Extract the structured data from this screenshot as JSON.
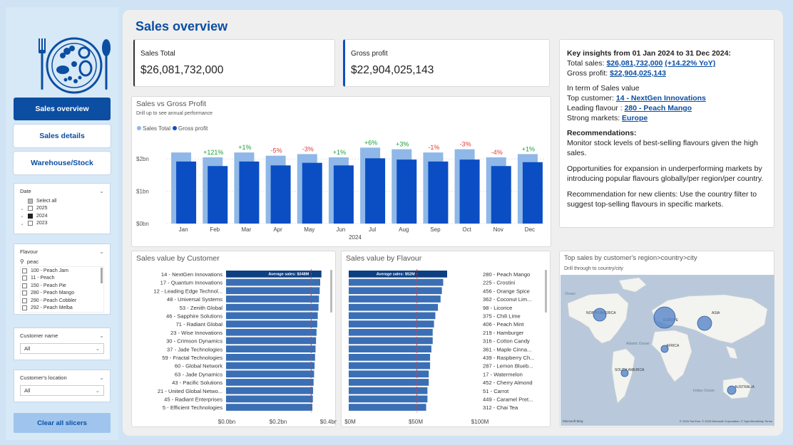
{
  "nav": {
    "buttons": [
      {
        "label": "Sales overview",
        "active": true
      },
      {
        "label": "Sales details",
        "active": false
      },
      {
        "label": "Warehouse/Stock",
        "active": false
      }
    ],
    "clear_label": "Clear all slicers"
  },
  "slicers": {
    "date": {
      "title": "Date",
      "select_all": "Select all",
      "years": [
        {
          "label": "2025",
          "state": "unchecked"
        },
        {
          "label": "2024",
          "state": "checked"
        },
        {
          "label": "2023",
          "state": "unchecked"
        }
      ]
    },
    "flavour": {
      "title": "Flavour",
      "search_value": "peac",
      "items": [
        "100 - Peach Jam",
        "11 - Peach",
        "150 - Peach Pie",
        "280 - Peach Mango",
        "290 - Peach Cobbler",
        "292 - Peach Melba"
      ]
    },
    "customer_name": {
      "title": "Customer name",
      "value": "All"
    },
    "customer_location": {
      "title": "Customer's location",
      "value": "All"
    }
  },
  "page": {
    "title": "Sales overview"
  },
  "kpis": {
    "sales_total": {
      "label": "Sales Total",
      "value": "$26,081,732,000"
    },
    "gross_profit": {
      "label": "Gross profit",
      "value": "$22,904,025,143"
    }
  },
  "colors": {
    "sales": "#8fb8e8",
    "profit": "#0b4ec4",
    "bar_blue": "#3a6fb5",
    "bar_dark": "#0d3f82",
    "positive": "#1a9e3a",
    "negative": "#e03a3a",
    "accent": "#0b4ea2"
  },
  "insights": {
    "heading": "Key insights from 01 Jan 2024 to 31 Dec 2024:",
    "total_sales_label": "Total sales:",
    "total_sales_value": "$26,081,732,000",
    "total_sales_yoy": "(+14.22% YoY)",
    "gross_profit_label": "Gross profit:",
    "gross_profit_value": "$22,904,025,143",
    "term_line": "In term of Sales value",
    "top_customer_label": "Top customer:",
    "top_customer_value": "14 - NextGen Innovations",
    "leading_flavour_label": "Leading flavour :",
    "leading_flavour_value": "280 - Peach Mango",
    "strong_markets_label": "Strong markets:",
    "strong_markets_value": "Europe",
    "recommendations_heading": "Recommendations:",
    "rec1": "Monitor stock levels of best-selling flavours given the high sales.",
    "rec2": "Opportunities for expansion in underperforming markets by introducing popular flavours globally/per region/per country.",
    "rec3": "Recommendation for new clients: Use the country filter to suggest top-selling flavours in specific markets."
  },
  "map": {
    "title": "Top sales by customer's region>country>city",
    "subtitle": "Drill through to country/city",
    "regions": [
      {
        "label": "NORTH AMERICA",
        "size": 9
      },
      {
        "label": "EUROPE",
        "size": 15
      },
      {
        "label": "ASIA",
        "size": 10
      },
      {
        "label": "AFRICA",
        "size": 5
      },
      {
        "label": "SOUTH AMERICA",
        "size": 5
      },
      {
        "label": "AUSTRALIA",
        "size": 6
      }
    ],
    "ocean_labels": [
      "Ocean",
      "Atlantic Ocean",
      "Indian Ocean"
    ],
    "footer_left": "Microsoft Bing",
    "footer_right": "© 2025 TomTom, © 2025 Microsoft Corporation, © OpenStreetMap  Terms"
  },
  "chart_data": [
    {
      "type": "bar",
      "title": "Sales vs Gross Profit",
      "subtitle": "Drill up to see annual performance",
      "categories": [
        "Jan",
        "Feb",
        "Mar",
        "Apr",
        "May",
        "Jun",
        "Jul",
        "Aug",
        "Sep",
        "Oct",
        "Nov",
        "Dec"
      ],
      "series": [
        {
          "name": "Sales Total",
          "values": [
            2.2,
            2.05,
            2.2,
            2.1,
            2.15,
            2.05,
            2.35,
            2.3,
            2.2,
            2.3,
            2.05,
            2.15
          ]
        },
        {
          "name": "Gross profit",
          "values": [
            1.92,
            1.78,
            1.92,
            1.8,
            1.88,
            1.8,
            2.02,
            1.98,
            1.92,
            1.98,
            1.78,
            1.9
          ]
        }
      ],
      "annotations": [
        "",
        "+121%",
        "+1%",
        "-5%",
        "-3%",
        "+1%",
        "+6%",
        "+3%",
        "-1%",
        "-3%",
        "-4%",
        "+1%"
      ],
      "yticks": [
        "$0bn",
        "$1bn",
        "$2bn"
      ],
      "ylim": [
        0,
        2.6
      ],
      "xlabel": "2024",
      "legend": "top-left"
    },
    {
      "type": "bar",
      "orientation": "horizontal",
      "title": "Sales value by Customer",
      "categories": [
        "14 - NextGen Innovations",
        "17 - Quantum Innovations",
        "12 - Leading Edge Technol...",
        "48 - Universal Systems",
        "53 - Zenith Global",
        "46 - Sapphire Solutions",
        "71 - Radiant Global",
        "23 - Wise Innovations",
        "30 - Crimson Dynamics",
        "37 - Jade Technologies",
        "59 - Fractal Technologies",
        "60 - Global Network",
        "63 - Jade Dynamics",
        "43 - Pacific Solutions",
        "21 - United Global Netwo...",
        "45 - Radiant Enterprises",
        "5 - Efficient Technologies"
      ],
      "values": [
        0.39,
        0.385,
        0.383,
        0.38,
        0.378,
        0.375,
        0.373,
        0.37,
        0.368,
        0.366,
        0.364,
        0.362,
        0.36,
        0.358,
        0.356,
        0.355,
        0.353
      ],
      "xticks": [
        "$0.0bn",
        "$0.2bn",
        "$0.4bn"
      ],
      "xlim": [
        0,
        0.42
      ],
      "average_label": "Average sales: $348M",
      "average": 0.348
    },
    {
      "type": "bar",
      "orientation": "horizontal",
      "title": "Sales value by Flavour",
      "categories": [
        "280 - Peach Mango",
        "225 - Crostini",
        "456 - Orange Spice",
        "362 - Coconut Lim...",
        "98 - Licorice",
        "375 - Chili Lime",
        "406 - Peach Mint",
        "219 - Hamburger",
        "316 - Cotton Candy",
        "361 - Maple Cinna...",
        "439 - Raspberry Ch...",
        "287 - Lemon Blueb...",
        "17 - Watermelon",
        "452 - Cherry Almond",
        "51 - Carrot",
        "449 - Caramel Pret...",
        "312 - Chai Tea"
      ],
      "values": [
        75,
        72,
        71,
        70,
        68,
        66,
        65,
        64,
        64,
        63,
        62,
        62,
        61,
        61,
        60,
        60,
        59
      ],
      "xticks": [
        "$0M",
        "$50M",
        "$100M"
      ],
      "xlim": [
        0,
        100
      ],
      "average_label": "Average sales: $52M",
      "average": 52
    }
  ]
}
